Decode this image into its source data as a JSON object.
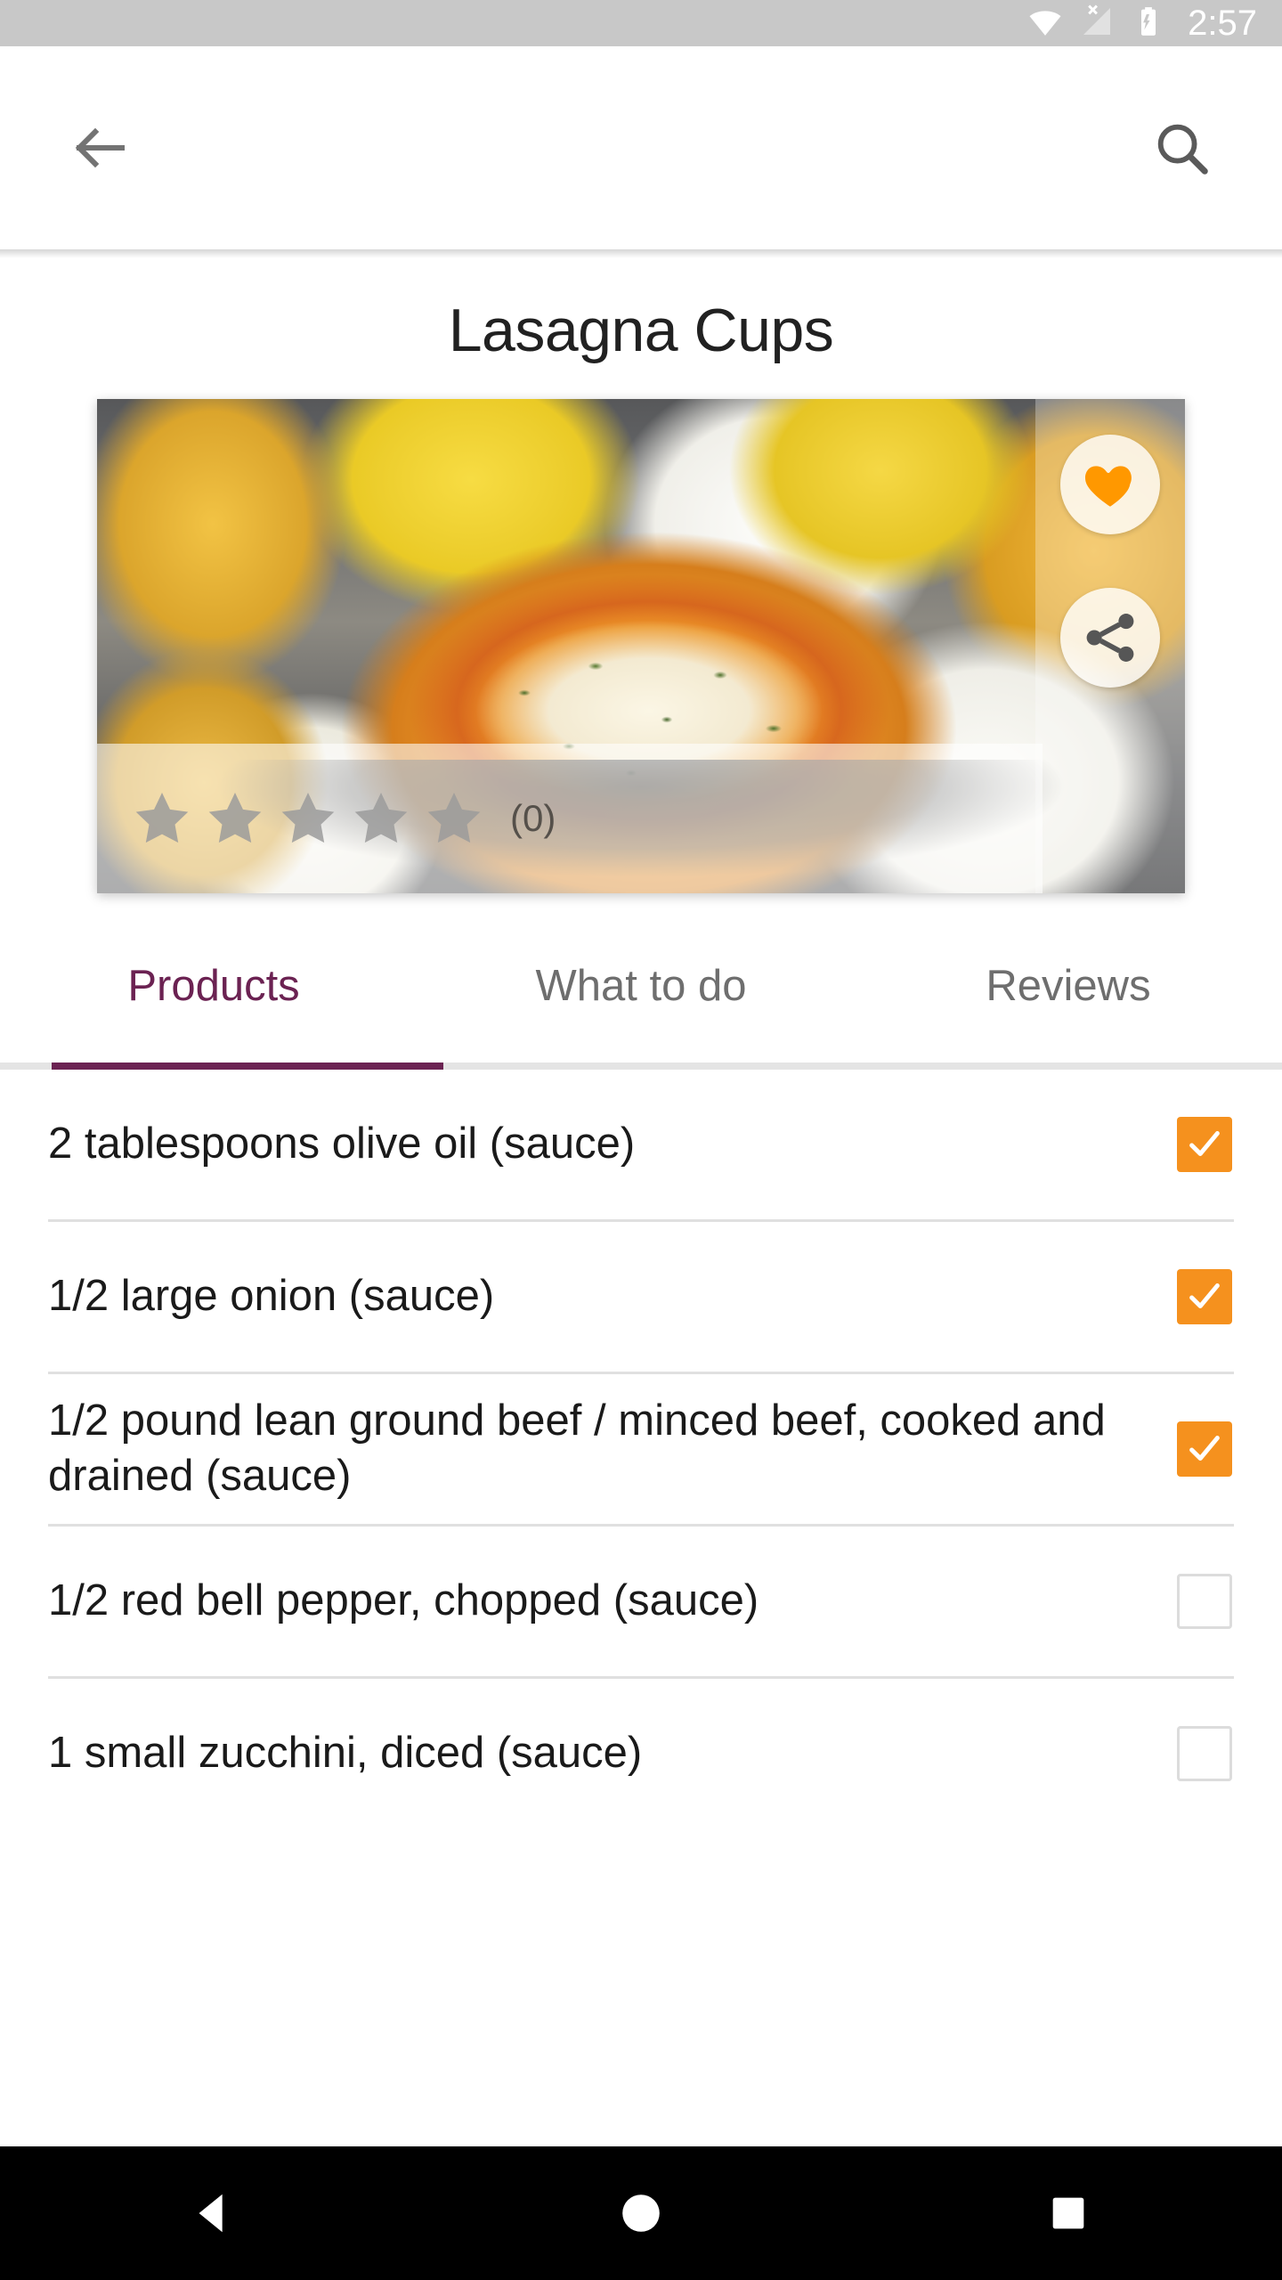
{
  "statusbar": {
    "time": "2:57",
    "icons": [
      "wifi-icon",
      "cellular-no-sim-icon",
      "battery-charging-icon"
    ],
    "background_color": "#c8c8c8",
    "foreground_color": "#ffffff"
  },
  "toolbar": {
    "back_label": "back-arrow",
    "search_label": "search"
  },
  "recipe": {
    "title": "Lasagna Cups",
    "favorite_active": true,
    "favorite_color": "#FF9800",
    "share_color": "#565656"
  },
  "rating": {
    "stars_total": 5,
    "stars_filled": 0,
    "count_label": "(0)",
    "star_color": "#9b9b9b"
  },
  "tabs": {
    "active_index": 0,
    "accent_color": "#6b2252",
    "items": [
      {
        "label": "Products"
      },
      {
        "label": "What to do"
      },
      {
        "label": "Reviews"
      }
    ]
  },
  "ingredients": {
    "checkbox_checked_color": "#F5911E",
    "items": [
      {
        "text": "2 tablespoons olive oil (sauce)",
        "checked": true
      },
      {
        "text": "1/2 large onion (sauce)",
        "checked": true
      },
      {
        "text": "1/2 pound lean ground beef / minced beef, cooked and drained (sauce)",
        "checked": true
      },
      {
        "text": "1/2 red bell pepper, chopped (sauce)",
        "checked": false
      },
      {
        "text": "1 small zucchini, diced (sauce)",
        "checked": false
      }
    ]
  },
  "navbar": {
    "background_color": "#000000",
    "items": [
      {
        "name": "back-nav-icon"
      },
      {
        "name": "home-nav-icon"
      },
      {
        "name": "recents-nav-icon"
      }
    ]
  }
}
